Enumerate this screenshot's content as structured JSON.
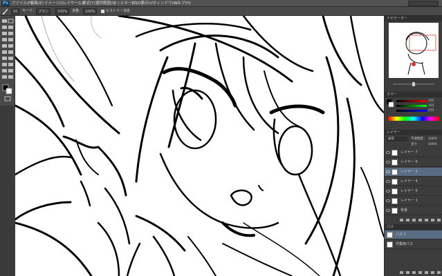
{
  "app": {
    "logo": "Ps"
  },
  "menu": [
    "ファイル(F)",
    "編集(E)",
    "イメージ(I)",
    "レイヤー(L)",
    "書式(Y)",
    "選択範囲(S)",
    "フィルター(T)",
    "3D(D)",
    "表示(V)",
    "ウィンドウ(W)",
    "ヘルプ(H)"
  ],
  "options": {
    "size": "10",
    "mode": "モード：",
    "mode_value": "ブラシ",
    "opacity": "100%",
    "flow_label": "流量：",
    "flow": "100%",
    "erase_history": "ヒストリー消去"
  },
  "navigator": {
    "tab": "ナビゲーター"
  },
  "color": {
    "tab": "カラー",
    "r": "255",
    "g": "255",
    "b": "255"
  },
  "layers": {
    "tab": "レイヤー",
    "blend_mode": "通常",
    "opacity_label": "不透明度：",
    "opacity": "100%",
    "fill_label": "塗り：",
    "fill": "100%",
    "items": [
      {
        "name": "レイヤー 7"
      },
      {
        "name": "レイヤー 6"
      },
      {
        "name": "レイヤー 3"
      },
      {
        "name": "レイヤー 4"
      },
      {
        "name": "レイヤー 5"
      },
      {
        "name": "レイヤー 1"
      },
      {
        "name": "背景"
      }
    ]
  },
  "paths": {
    "tab": "パス",
    "items": [
      {
        "name": "パス 1"
      },
      {
        "name": "作業用パス"
      }
    ]
  },
  "colors": {
    "chrome": "#535353",
    "panel": "#3c3c3c",
    "selection": "#586c84",
    "canvas": "#ffffff",
    "ink": "#000000"
  }
}
